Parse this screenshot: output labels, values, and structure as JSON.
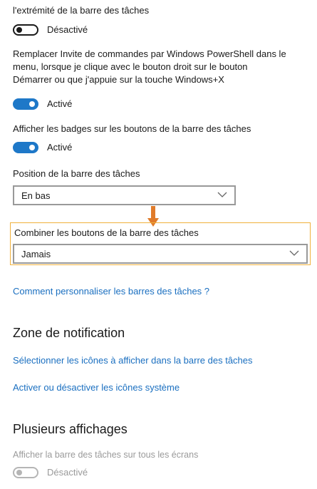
{
  "settings": {
    "top_label": "l'extrémité de la barre des tâches",
    "toggle1": {
      "state_label": "Désactivé",
      "state": "off"
    },
    "powershell_label_lines": [
      "Remplacer Invite de commandes par Windows PowerShell dans le",
      "menu, lorsque je clique avec le bouton droit sur le bouton",
      "Démarrer ou que j'appuie sur la touche Windows+X"
    ],
    "toggle2": {
      "state_label": "Activé",
      "state": "on"
    },
    "badges_label": "Afficher les badges sur les boutons de la barre des tâches",
    "toggle3": {
      "state_label": "Activé",
      "state": "on"
    },
    "position_label": "Position de la barre des tâches",
    "position_value": "En bas",
    "combine_label": "Combiner les boutons de la barre des tâches",
    "combine_value": "Jamais",
    "customize_link": "Comment personnaliser les barres des tâches ?"
  },
  "notification": {
    "heading": "Zone de notification",
    "link_icons": "Sélectionner les icônes à afficher dans la barre des tâches",
    "link_system": "Activer ou désactiver les icônes système"
  },
  "multi_display": {
    "heading": "Plusieurs affichages",
    "all_screens_label": "Afficher la barre des tâches sur tous les écrans",
    "toggle4": {
      "state_label": "Désactivé",
      "state": "disabled"
    }
  },
  "colors": {
    "accent": "#1e78c8",
    "link": "#1a6fc0",
    "highlight": "#f0b13c",
    "arrow": "#e07b2a"
  },
  "icons": {
    "dropdown": "chevron-down-icon",
    "annotation": "arrow-down-icon"
  }
}
